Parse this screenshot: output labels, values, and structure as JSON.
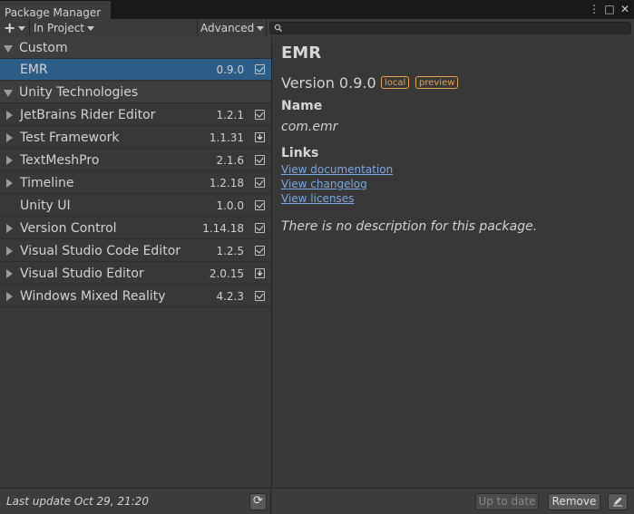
{
  "window": {
    "tab_title": "Package Manager",
    "controls": [
      "⋮",
      "□",
      "✕"
    ]
  },
  "toolbar": {
    "add_label": "+",
    "scope_label": "In Project",
    "advanced_label": "Advanced",
    "search_placeholder": ""
  },
  "list": {
    "groups": [
      {
        "name": "Custom",
        "packages": [
          {
            "name": "EMR",
            "version": "0.9.0",
            "status": "installed",
            "selected": true,
            "expandable": false
          }
        ]
      },
      {
        "name": "Unity Technologies",
        "packages": [
          {
            "name": "JetBrains Rider Editor",
            "version": "1.2.1",
            "status": "installed",
            "expandable": true
          },
          {
            "name": "Test Framework",
            "version": "1.1.31",
            "status": "update",
            "expandable": true
          },
          {
            "name": "TextMeshPro",
            "version": "2.1.6",
            "status": "installed",
            "expandable": true
          },
          {
            "name": "Timeline",
            "version": "1.2.18",
            "status": "installed",
            "expandable": true
          },
          {
            "name": "Unity UI",
            "version": "1.0.0",
            "status": "installed",
            "expandable": false
          },
          {
            "name": "Version Control",
            "version": "1.14.18",
            "status": "installed",
            "expandable": true
          },
          {
            "name": "Visual Studio Code Editor",
            "version": "1.2.5",
            "status": "installed",
            "expandable": true
          },
          {
            "name": "Visual Studio Editor",
            "version": "2.0.15",
            "status": "update",
            "expandable": true
          },
          {
            "name": "Windows Mixed Reality",
            "version": "4.2.3",
            "status": "installed",
            "expandable": true
          }
        ]
      }
    ],
    "footer": {
      "last_update": "Last update Oct 29, 21:20"
    }
  },
  "details": {
    "title": "EMR",
    "version": "Version 0.9.0",
    "tags": [
      "local",
      "preview"
    ],
    "name_heading": "Name",
    "package_id": "com.emr",
    "links_heading": "Links",
    "links": [
      "View documentation",
      "View changelog",
      "View licenses"
    ],
    "description": "There is no description for this package.",
    "footer": {
      "up_to_date": "Up to date",
      "remove": "Remove"
    }
  },
  "colors": {
    "selected_row": "#2c5d87",
    "link": "#7ba7e3",
    "tag": "#e6a149"
  }
}
